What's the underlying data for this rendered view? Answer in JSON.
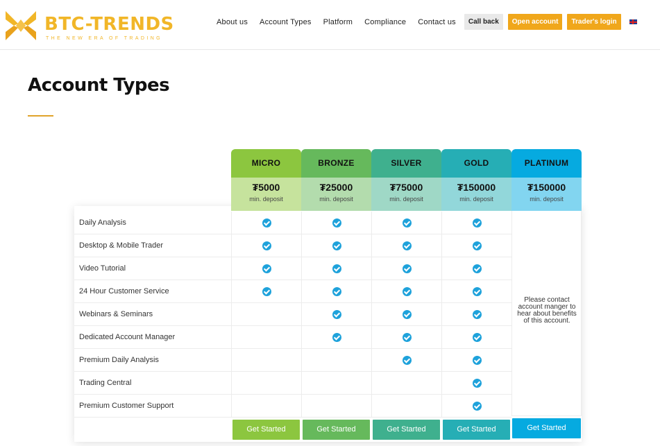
{
  "brand": {
    "name": "BTC-TRENDS",
    "tagline": "THE NEW ERA OF TRADING"
  },
  "nav": {
    "links": [
      "About us",
      "Account Types",
      "Platform",
      "Compliance",
      "Contact us"
    ],
    "callback": "Call back",
    "open_account": "Open account",
    "traders_login": "Trader's login",
    "language_icon": "uk-flag-icon"
  },
  "page": {
    "title": "Account Types"
  },
  "colors": {
    "accent": "#f0a71b",
    "check": "#1ea2db",
    "micro": "#8cc63f",
    "bronze": "#66b95c",
    "silver": "#3fb08e",
    "gold": "#26aeb5",
    "platinum": "#06aae0"
  },
  "plans": [
    {
      "name": "MICRO",
      "price": "₮5000",
      "sub": "min. deposit",
      "cta": "Get Started"
    },
    {
      "name": "BRONZE",
      "price": "₮25000",
      "sub": "min. deposit",
      "cta": "Get Started"
    },
    {
      "name": "SILVER",
      "price": "₮75000",
      "sub": "min. deposit",
      "cta": "Get Started"
    },
    {
      "name": "GOLD",
      "price": "₮150000",
      "sub": "min. deposit",
      "cta": "Get Started"
    },
    {
      "name": "PLATINUM",
      "price": "₮150000",
      "sub": "min. deposit",
      "cta": "Get Started"
    }
  ],
  "features": [
    {
      "label": "Daily Analysis",
      "included": [
        true,
        true,
        true,
        true
      ]
    },
    {
      "label": "Desktop & Mobile Trader",
      "included": [
        true,
        true,
        true,
        true
      ]
    },
    {
      "label": "Video Tutorial",
      "included": [
        true,
        true,
        true,
        true
      ]
    },
    {
      "label": "24 Hour Customer Service",
      "included": [
        true,
        true,
        true,
        true
      ]
    },
    {
      "label": "Webinars & Seminars",
      "included": [
        false,
        true,
        true,
        true
      ]
    },
    {
      "label": "Dedicated Account Manager",
      "included": [
        false,
        true,
        true,
        true
      ]
    },
    {
      "label": "Premium Daily Analysis",
      "included": [
        false,
        false,
        true,
        true
      ]
    },
    {
      "label": "Trading Central",
      "included": [
        false,
        false,
        false,
        true
      ]
    },
    {
      "label": "Premium Customer Support",
      "included": [
        false,
        false,
        false,
        true
      ]
    }
  ],
  "platinum_note": "Please contact account manger to hear about benefits of this account."
}
